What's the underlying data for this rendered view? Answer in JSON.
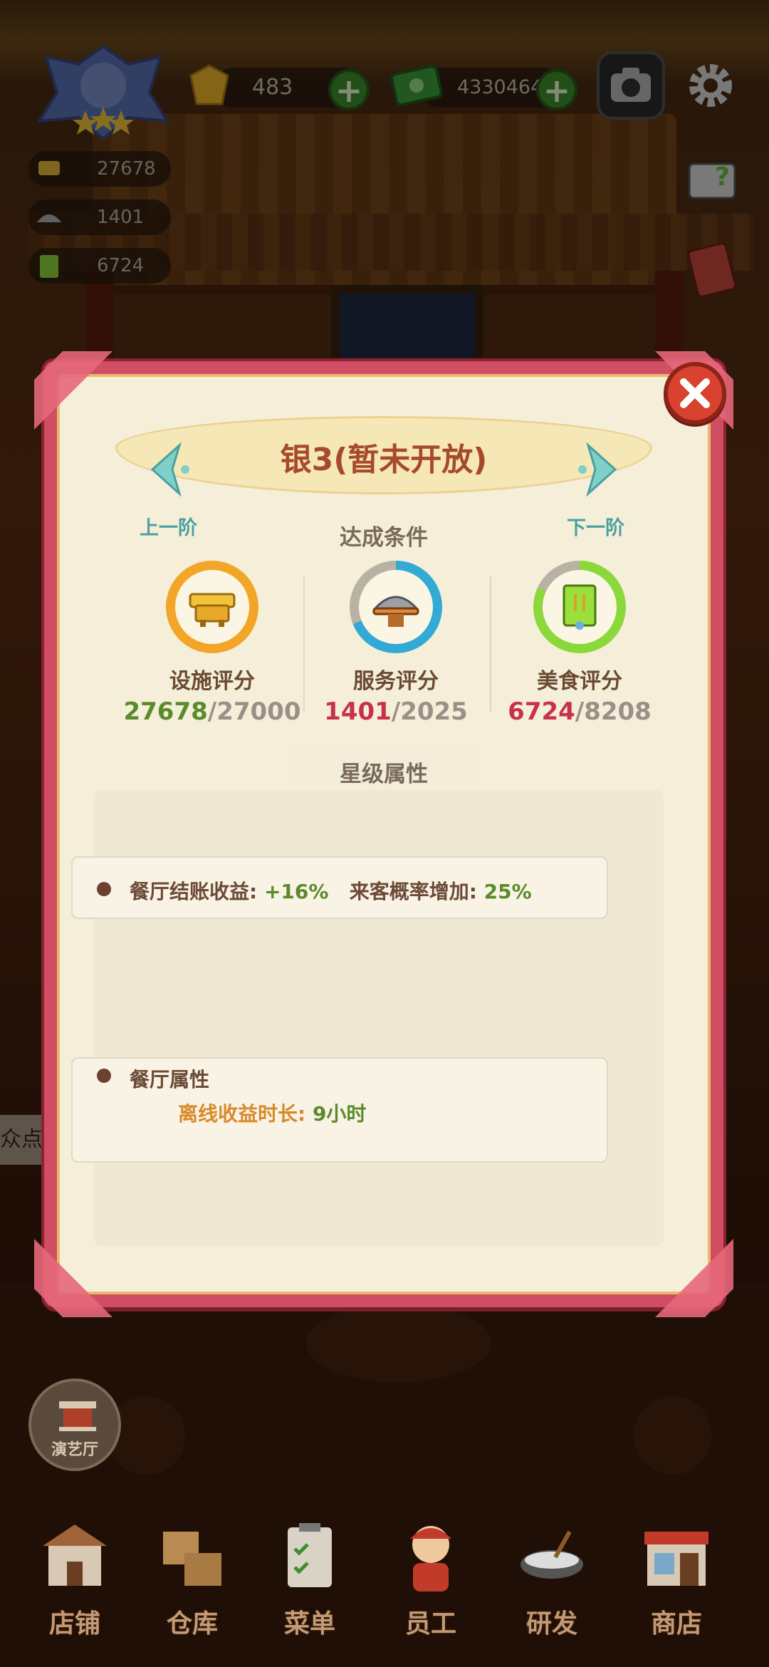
{
  "hud": {
    "gems": "483",
    "cash": "4330464",
    "facility_score": "27678",
    "service_score": "1401",
    "food_score": "6724"
  },
  "modal": {
    "title": "银3(暂未开放)",
    "prev_tier": "上一阶",
    "next_tier": "下一阶",
    "conditions_header": "达成条件",
    "scores": [
      {
        "name": "设施评分",
        "current": "27678",
        "required": "/27000",
        "ring_color": "#f2a527",
        "progress": 1.0
      },
      {
        "name": "服务评分",
        "current": "1401",
        "required": "/2025",
        "ring_color": "#33a9d6",
        "progress": 0.69
      },
      {
        "name": "美食评分",
        "current": "6724",
        "required": "/8208",
        "ring_color": "#8ad83a",
        "progress": 0.82
      }
    ],
    "attributes_header": "星级属性",
    "bonus": {
      "label1": "餐厅结账收益:",
      "value1": "+16%",
      "label2": "来客概率增加:",
      "value2": "25%"
    },
    "restaurant": {
      "title": "餐厅属性",
      "offline_label": "离线收益时长:",
      "offline_value": "9小时"
    }
  },
  "side_tag": "众点评",
  "stage_button": "演艺厅",
  "nav": [
    "店铺",
    "仓库",
    "菜单",
    "员工",
    "研发",
    "商店"
  ],
  "colors": {
    "modal_frame": "#d04e63",
    "parchment": "#f5efd9",
    "positive_green": "#5a8a2a",
    "deficit_red": "#c7324a"
  }
}
